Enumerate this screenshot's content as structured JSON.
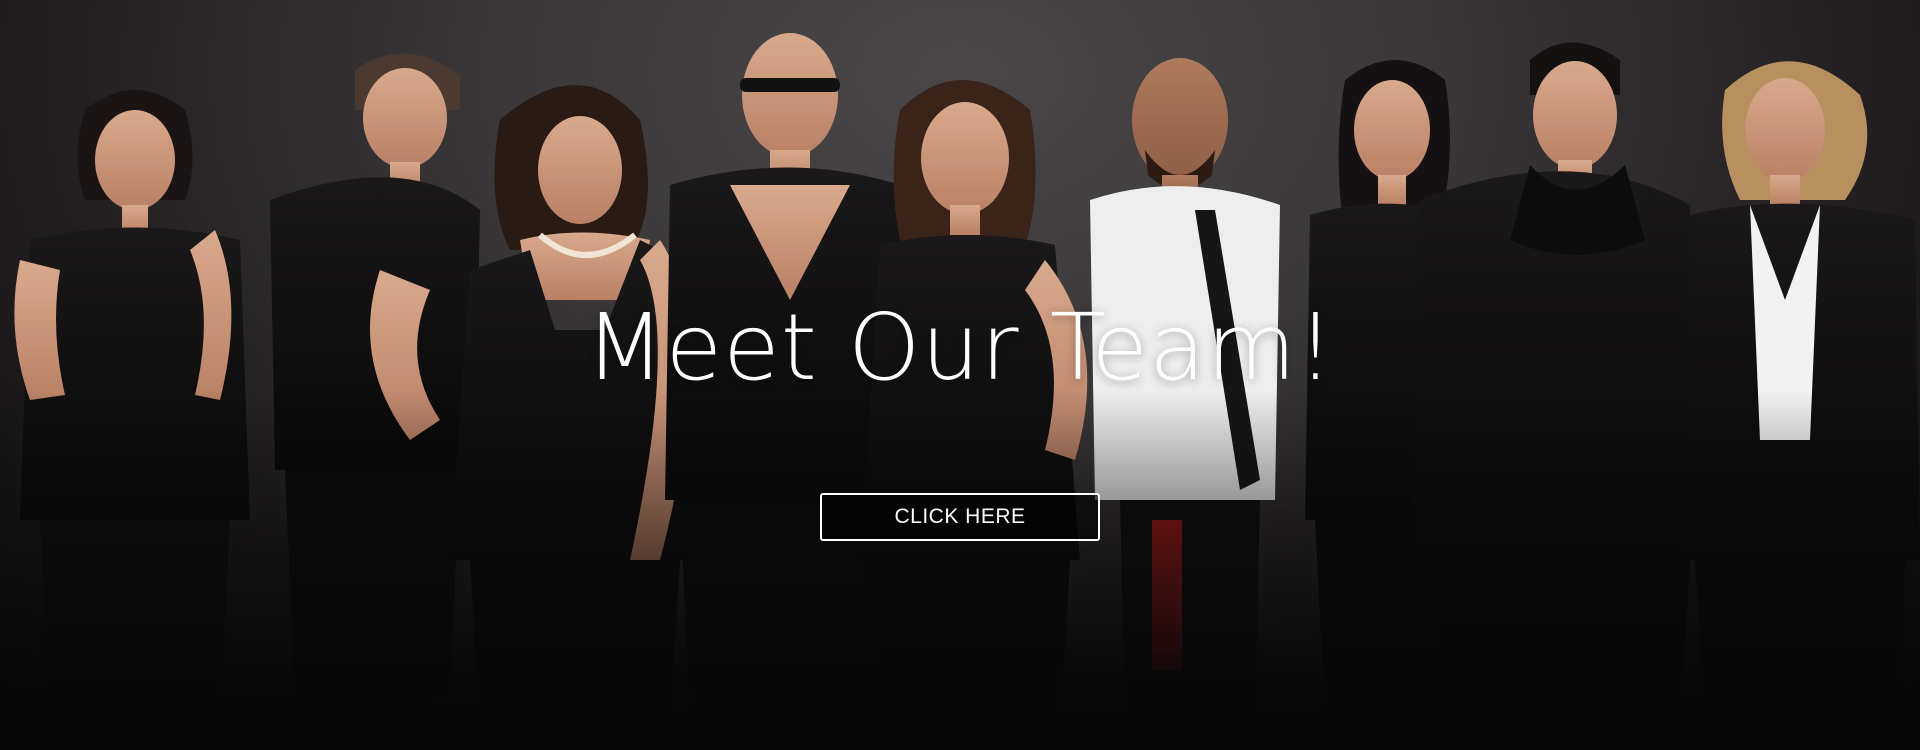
{
  "hero": {
    "title": "Meet Our Team!",
    "cta_label": "CLICK HERE"
  },
  "colors": {
    "background": "#3a3739",
    "title_text": "#ffffff",
    "button_border": "#ffffff"
  }
}
